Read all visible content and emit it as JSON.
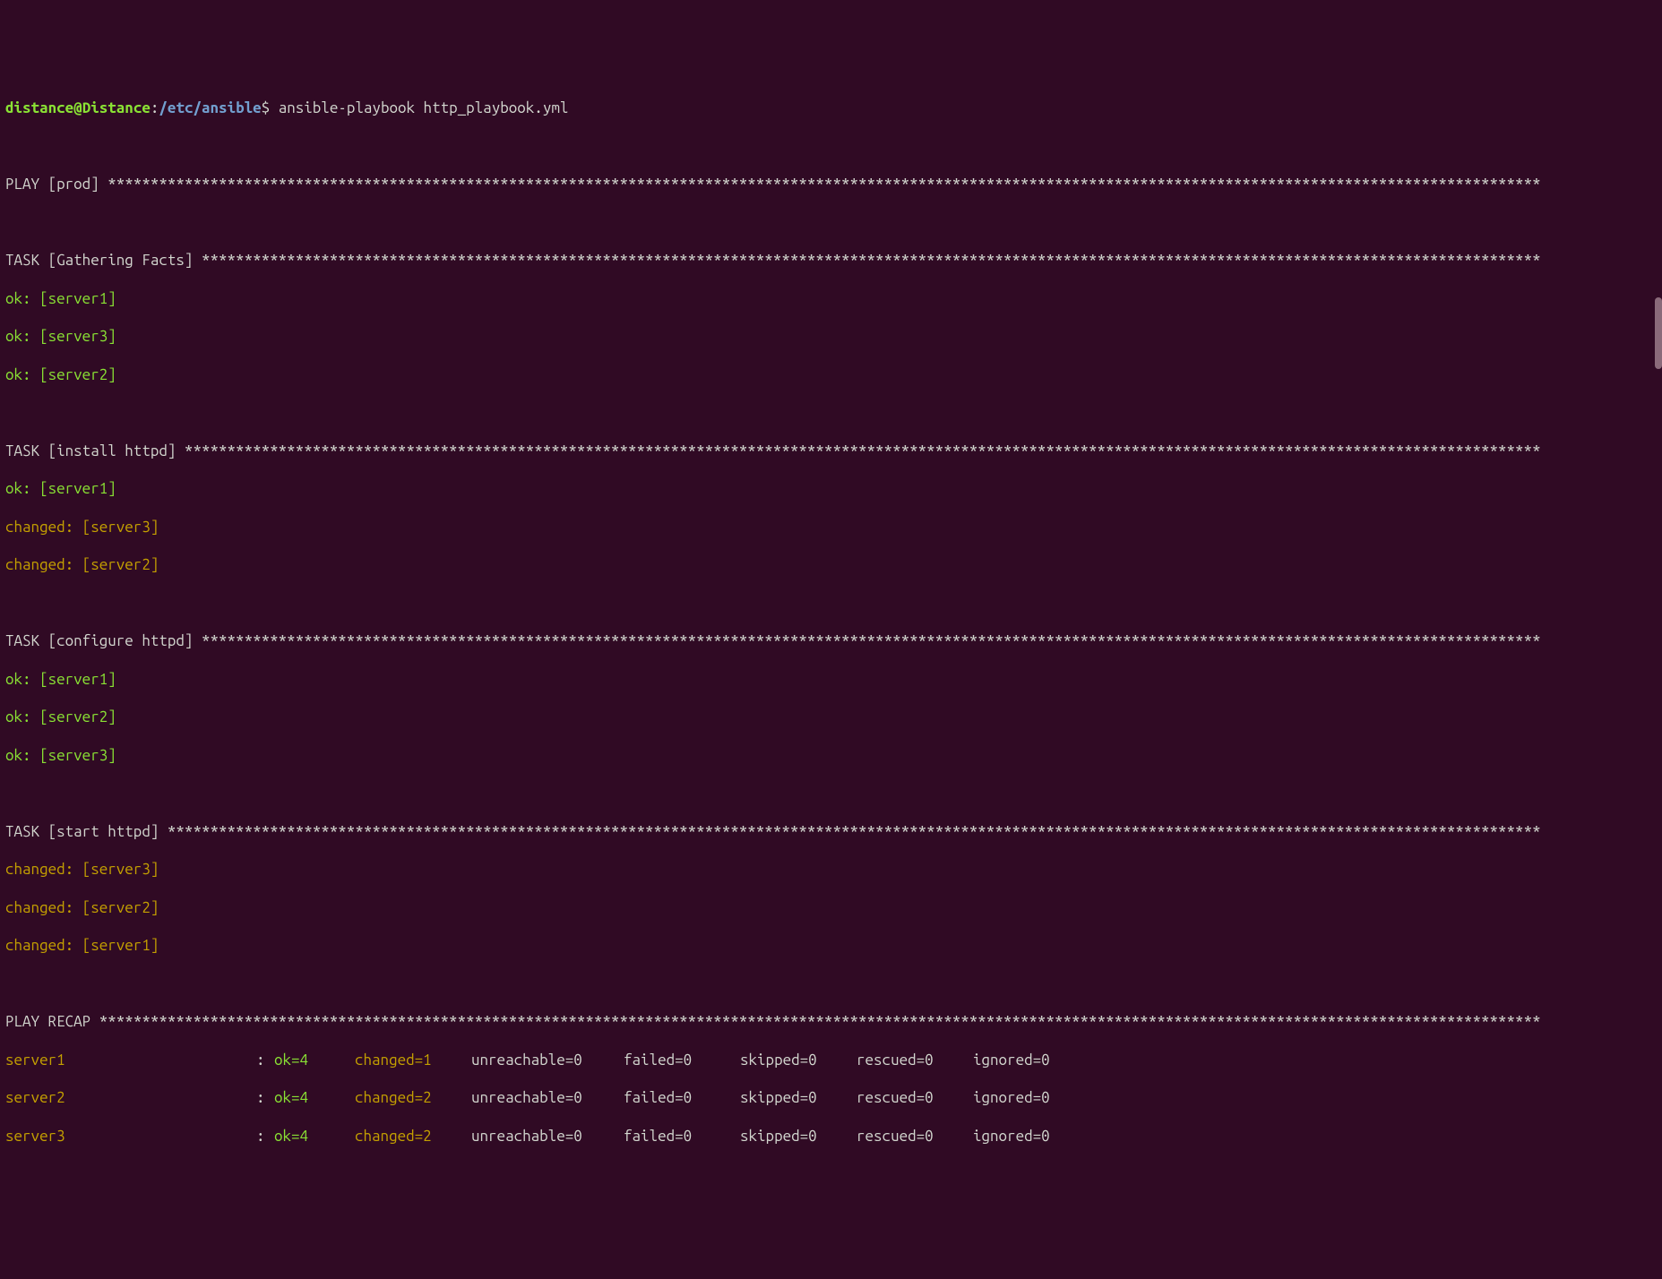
{
  "prompt": {
    "user": "distance",
    "at": "@",
    "host": "Distance",
    "colon": ":",
    "path": "/etc/ansible",
    "dollar": "$",
    "command": " ansible-playbook http_playbook.yml"
  },
  "play": {
    "label": "PLAY [prod] "
  },
  "tasks": [
    {
      "label": "TASK [Gathering Facts] ",
      "results": [
        {
          "status": "ok",
          "host": "server1",
          "text": "ok: [server1]"
        },
        {
          "status": "ok",
          "host": "server3",
          "text": "ok: [server3]"
        },
        {
          "status": "ok",
          "host": "server2",
          "text": "ok: [server2]"
        }
      ]
    },
    {
      "label": "TASK [install httpd] ",
      "results": [
        {
          "status": "ok",
          "host": "server1",
          "text": "ok: [server1]"
        },
        {
          "status": "changed",
          "host": "server3",
          "text": "changed: [server3]"
        },
        {
          "status": "changed",
          "host": "server2",
          "text": "changed: [server2]"
        }
      ]
    },
    {
      "label": "TASK [configure httpd] ",
      "results": [
        {
          "status": "ok",
          "host": "server1",
          "text": "ok: [server1]"
        },
        {
          "status": "ok",
          "host": "server2",
          "text": "ok: [server2]"
        },
        {
          "status": "ok",
          "host": "server3",
          "text": "ok: [server3]"
        }
      ]
    },
    {
      "label": "TASK [start httpd] ",
      "results": [
        {
          "status": "changed",
          "host": "server3",
          "text": "changed: [server3]"
        },
        {
          "status": "changed",
          "host": "server2",
          "text": "changed: [server2]"
        },
        {
          "status": "changed",
          "host": "server1",
          "text": "changed: [server1]"
        }
      ]
    }
  ],
  "recap": {
    "label": "PLAY RECAP ",
    "rows": [
      {
        "host": "server1",
        "colon": ":",
        "ok": "ok=4",
        "changed": "changed=1",
        "unreachable": "unreachable=0",
        "failed": "failed=0",
        "skipped": "skipped=0",
        "rescued": "rescued=0",
        "ignored": "ignored=0"
      },
      {
        "host": "server2",
        "colon": ":",
        "ok": "ok=4",
        "changed": "changed=2",
        "unreachable": "unreachable=0",
        "failed": "failed=0",
        "skipped": "skipped=0",
        "rescued": "rescued=0",
        "ignored": "ignored=0"
      },
      {
        "host": "server3",
        "colon": ":",
        "ok": "ok=4",
        "changed": "changed=2",
        "unreachable": "unreachable=0",
        "failed": "failed=0",
        "skipped": "skipped=0",
        "rescued": "rescued=0",
        "ignored": "ignored=0"
      }
    ]
  }
}
